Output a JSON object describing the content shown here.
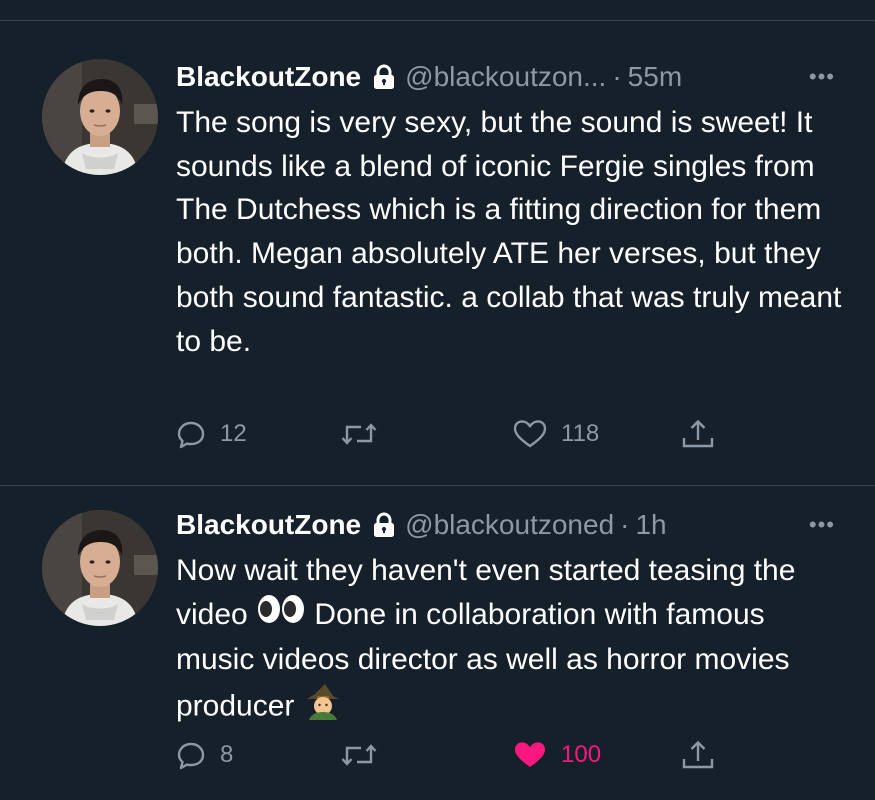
{
  "tweets": [
    {
      "author_name": "BlackoutZone",
      "handle": "@blackoutzon...",
      "separator": "·",
      "time": "55m",
      "text": "The song is very sexy, but the sound is sweet! It sounds like a blend of iconic Fergie singles from The Dutchess which is a fitting direction for them both. Megan absolutely ATE her verses, but they both sound fantastic. a collab that was truly meant to be.",
      "replies": "12",
      "retweets": "",
      "likes": "118",
      "liked": false
    },
    {
      "author_name": "BlackoutZone",
      "handle": "@blackoutzoned",
      "separator": "·",
      "time": "1h",
      "text_part1": "Now wait they haven't even started teasing the video",
      "emoji1": "eyes-emoji",
      "text_part2": "Done in collaboration with famous music videos director as well as horror movies producer",
      "emoji2": "witch-emoji",
      "replies": "8",
      "retweets": "",
      "likes": "100",
      "liked": true
    }
  ],
  "colors": {
    "background": "#15202b",
    "secondary_text": "#8b98a5",
    "divider": "#38444d",
    "like_pink": "#f91880"
  }
}
